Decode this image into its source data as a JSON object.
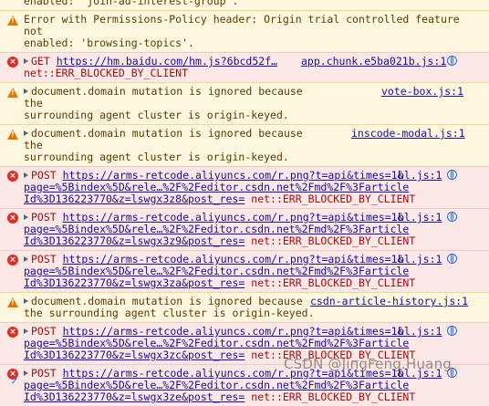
{
  "messages": [
    {
      "type": "warn",
      "lines": [
        "enabled: 'join-ad-interest-group'."
      ]
    },
    {
      "type": "warn",
      "lines": [
        "Error with Permissions-Policy header: Origin trial controlled feature not",
        "enabled: 'browsing-topics'."
      ]
    },
    {
      "type": "err",
      "method": "GET",
      "url": "https://hm.baidu.com/hm.js?6bcd52f…",
      "source": "app.chunk.e5ba021b.js:1",
      "after": "net::ERR_BLOCKED_BY_CLIENT"
    },
    {
      "type": "warn",
      "text": "document.domain mutation is ignored because the",
      "source": "vote-box.js:1",
      "line2": "surrounding agent cluster is origin-keyed."
    },
    {
      "type": "warn",
      "text": "document.domain mutation is ignored because the",
      "source": "inscode-modal.js:1",
      "line2": "surrounding agent cluster is origin-keyed."
    },
    {
      "type": "err",
      "method": "POST",
      "url1": "https://arms-retcode.aliyuncs.com/r.png?t=api&times=1&",
      "source": "bl.js:1",
      "url2": "page=%5Bindex%5D&rele…%2F%2Feditor.csdn.net%2Fmd%2F%3Farticle",
      "url3": "Id%3D136223770&z=lswgx3z8&post_res=",
      "after": "net::ERR_BLOCKED_BY_CLIENT"
    },
    {
      "type": "err",
      "method": "POST",
      "url1": "https://arms-retcode.aliyuncs.com/r.png?t=api&times=1&",
      "source": "bl.js:1",
      "url2": "page=%5Bindex%5D&rele…%2F%2Feditor.csdn.net%2Fmd%2F%3Farticle",
      "url3": "Id%3D136223770&z=lswgx3z9&post_res=",
      "after": "net::ERR_BLOCKED_BY_CLIENT"
    },
    {
      "type": "err",
      "method": "POST",
      "url1": "https://arms-retcode.aliyuncs.com/r.png?t=api&times=1&",
      "source": "bl.js:1",
      "url2": "page=%5Bindex%5D&rele…%2F%2Feditor.csdn.net%2Fmd%2F%3Farticle",
      "url3": "Id%3D136223770&z=lswgx3za&post_res=",
      "after": "net::ERR_BLOCKED_BY_CLIENT"
    },
    {
      "type": "warn",
      "text": "document.domain mutation is ignored because",
      "source": "csdn-article-history.js:1",
      "line2": "the surrounding agent cluster is origin-keyed."
    },
    {
      "type": "err",
      "method": "POST",
      "url1": "https://arms-retcode.aliyuncs.com/r.png?t=api&times=1&",
      "source": "bl.js:1",
      "url2": "page=%5Bindex%5D&rele…%2F%2Feditor.csdn.net%2Fmd%2F%3Farticle",
      "url3": "Id%3D136223770&z=lswgx3zc&post_res=",
      "after": "net::ERR_BLOCKED_BY_CLIENT"
    },
    {
      "type": "err",
      "method": "POST",
      "url1": "https://arms-retcode.aliyuncs.com/r.png?t=api&times=1&",
      "source": "bl.js:1",
      "url2": "page=%5Bindex%5D&rele…%2F%2Feditor.csdn.net%2Fmd%2F%3Farticle",
      "url3": "Id%3D136223770&z=lswgx3ze&post_res=",
      "after": "net::ERR_BLOCKED_BY_CLIENT"
    }
  ],
  "watermark": "CSDN @JingFeng.Huang",
  "colors": {
    "warn_bg": "#fef7e0",
    "err_bg": "#fce8e6",
    "link": "#1a0dab"
  }
}
